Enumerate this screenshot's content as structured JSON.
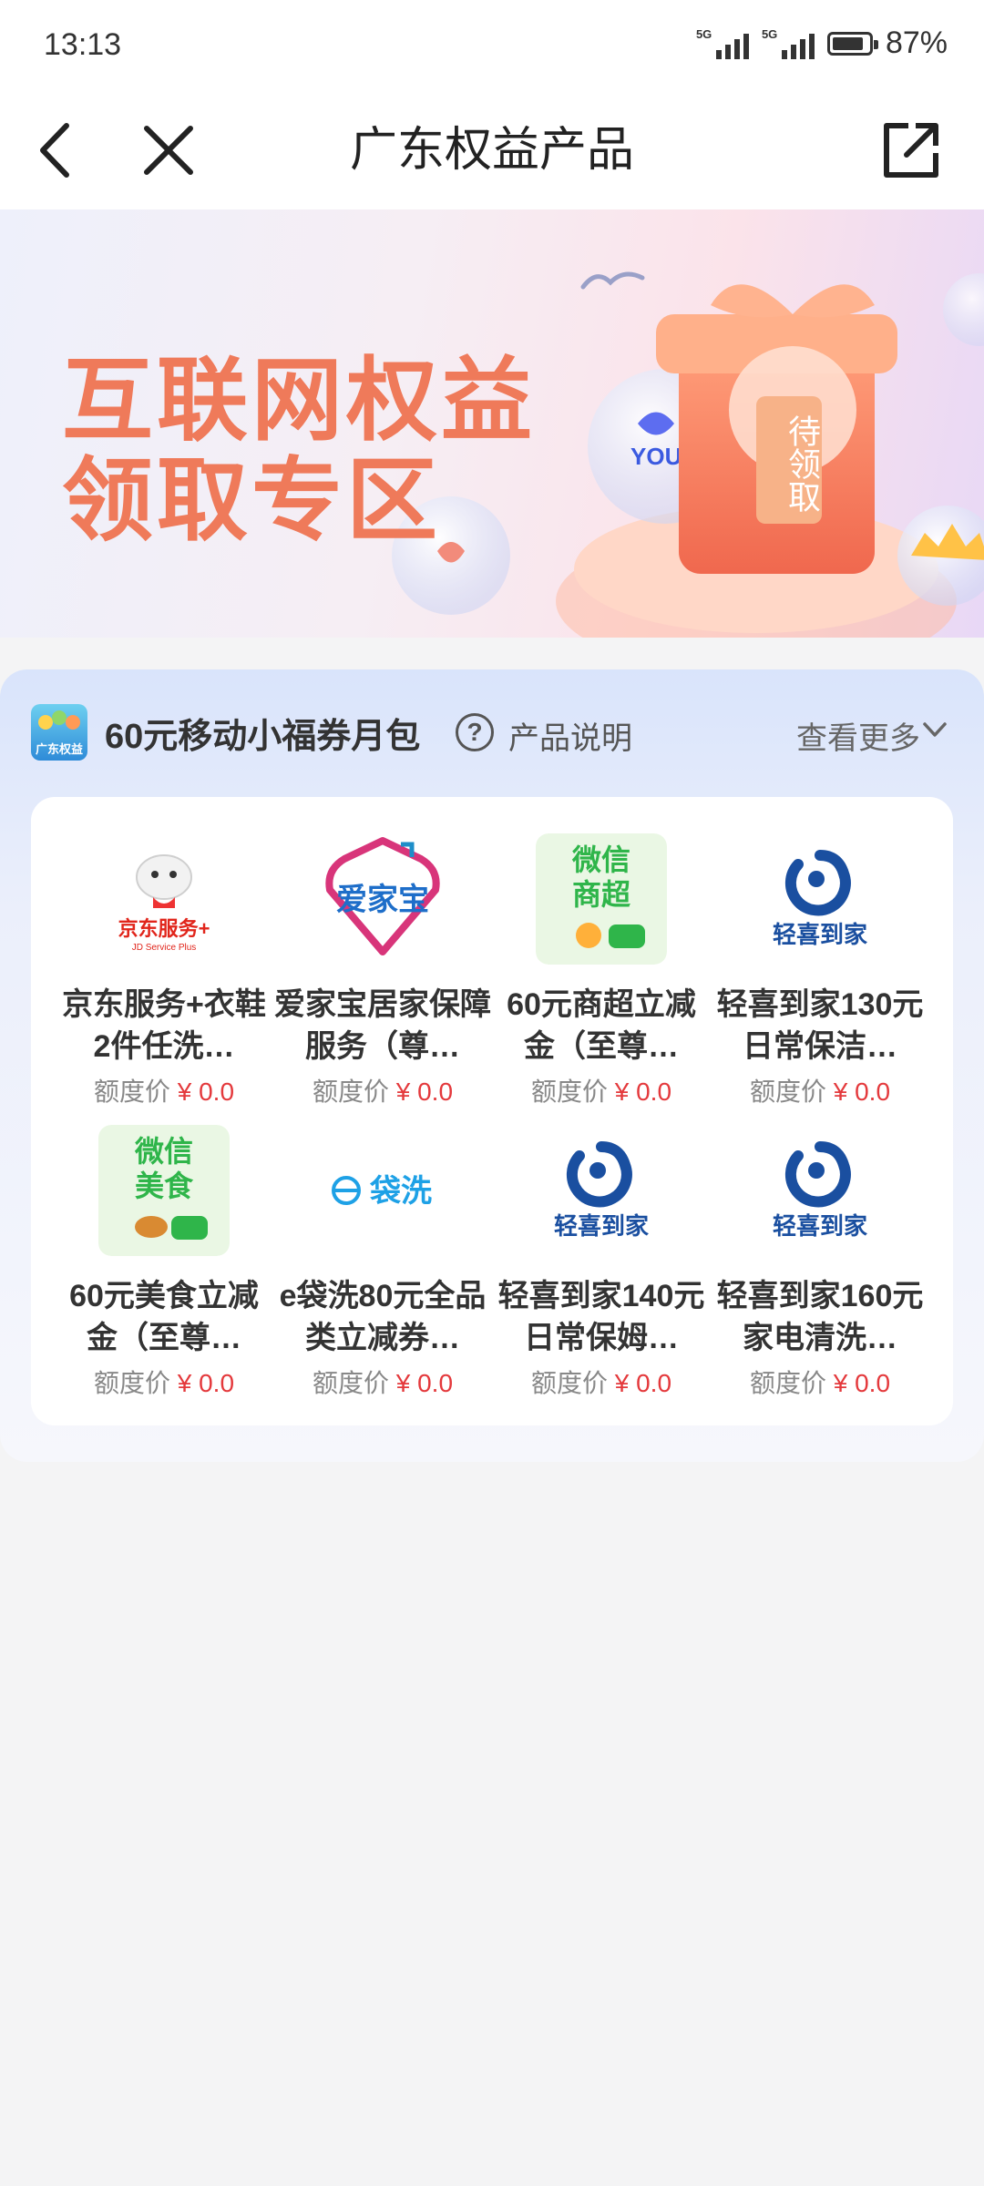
{
  "status": {
    "time": "13:13",
    "signal1": "5G",
    "signal2": "5G",
    "battery": "87%",
    "battery_level": 0.87
  },
  "nav": {
    "title": "广东权益产品"
  },
  "banner": {
    "line1": "互联网权益",
    "line2": "领取专区",
    "tag": "待领取",
    "partner_text": "YOUK"
  },
  "package": {
    "brand_text": "广东权益",
    "title": "60元移动小福券月包",
    "info": "产品说明",
    "more": "查看更多",
    "price_label": "额度价",
    "items": [
      {
        "name": "京东服务+衣鞋2件任洗…",
        "price": "¥ 0.0",
        "logo": "京东服务+",
        "logo_sub": "JD Service Plus"
      },
      {
        "name": "爱家宝居家保障服务（尊…",
        "price": "¥ 0.0",
        "logo": "爱家宝"
      },
      {
        "name": "60元商超立减金（至尊…",
        "price": "¥ 0.0",
        "logo": "微信商超"
      },
      {
        "name": "轻喜到家130元日常保洁…",
        "price": "¥ 0.0",
        "logo": "轻喜到家"
      },
      {
        "name": "60元美食立减金（至尊…",
        "price": "¥ 0.0",
        "logo": "微信美食"
      },
      {
        "name": "e袋洗80元全品类立减券…",
        "price": "¥ 0.0",
        "logo": "袋洗"
      },
      {
        "name": "轻喜到家140元日常保姆…",
        "price": "¥ 0.0",
        "logo": "轻喜到家"
      },
      {
        "name": "轻喜到家160元家电清洗…",
        "price": "¥ 0.0",
        "logo": "轻喜到家"
      }
    ]
  },
  "colors": {
    "accent_red": "#e4393c",
    "banner_text": "#ef7a5a",
    "wechat_green": "#2fb54a",
    "brand_blue": "#1a4fa0"
  }
}
